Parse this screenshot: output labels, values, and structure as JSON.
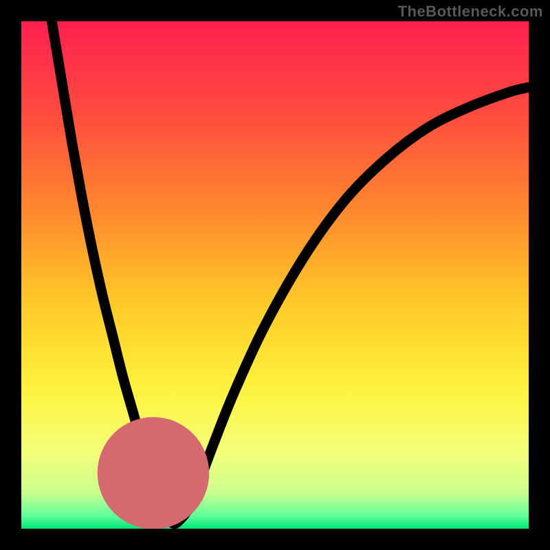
{
  "watermark": "TheBottleneck.com",
  "chart_data": {
    "type": "line",
    "title": "",
    "xlabel": "",
    "ylabel": "",
    "xlim": [
      0,
      100
    ],
    "ylim": [
      0,
      100
    ],
    "grid": false,
    "legend": false,
    "description": "Bottleneck curve on vertical rainbow gradient background. Two black curve branches descend from top-left and upper-right, meet near the bottom forming a rounded V; the trough is highlighted with a thick dotted salmon segment. Top band is red, mid is yellow, bottom edge is green.",
    "series": [
      {
        "name": "bottleneck-curve",
        "x": [
          6,
          8,
          10,
          12,
          14,
          16,
          18,
          20,
          22,
          24,
          26,
          27,
          28,
          29,
          30,
          31,
          33,
          35,
          38,
          42,
          48,
          56,
          64,
          72,
          80,
          88,
          96,
          100
        ],
        "y": [
          100,
          88,
          76,
          65,
          55,
          46,
          38,
          30,
          23,
          16,
          10,
          7,
          4,
          2,
          1,
          1.5,
          4,
          9,
          17,
          27,
          40,
          54,
          65,
          73,
          79,
          83,
          86,
          87
        ]
      }
    ],
    "highlight": {
      "name": "optimal-zone-marker",
      "x": [
        26,
        27.5,
        29,
        30.5,
        32.5,
        34.5
      ],
      "y": [
        11,
        6,
        3,
        2,
        3.5,
        8
      ]
    },
    "background_gradient_stops": [
      {
        "pos": 0.0,
        "color": "#ff1f4f"
      },
      {
        "pos": 0.18,
        "color": "#ff4b3f"
      },
      {
        "pos": 0.38,
        "color": "#ff8a2e"
      },
      {
        "pos": 0.55,
        "color": "#ffc828"
      },
      {
        "pos": 0.72,
        "color": "#fff23c"
      },
      {
        "pos": 0.85,
        "color": "#f4ff7a"
      },
      {
        "pos": 0.93,
        "color": "#c9ff8f"
      },
      {
        "pos": 0.975,
        "color": "#5fff9a"
      },
      {
        "pos": 1.0,
        "color": "#00e57a"
      }
    ]
  }
}
